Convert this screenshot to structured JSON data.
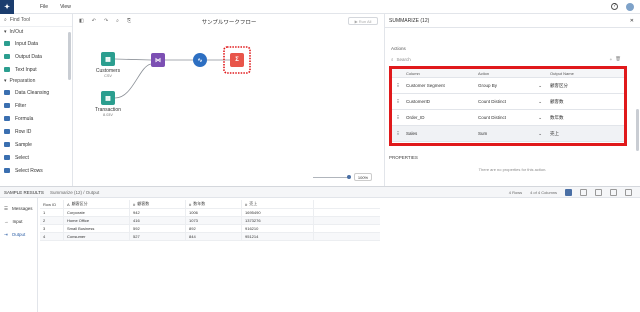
{
  "menu": {
    "file": "File",
    "view": "View"
  },
  "left_panel": {
    "find_tool": "Find Tool",
    "sections": [
      {
        "label": "In/Out",
        "items": [
          {
            "label": "Input Data",
            "color": "#2b9e8f"
          },
          {
            "label": "Output Data",
            "color": "#2b9e8f"
          },
          {
            "label": "Text Input",
            "color": "#2b9e8f"
          }
        ]
      },
      {
        "label": "Preparation",
        "items": [
          {
            "label": "Data Cleansing",
            "color": "#3a6fb0"
          },
          {
            "label": "Filter",
            "color": "#3a6fb0"
          },
          {
            "label": "Formula",
            "color": "#3a6fb0"
          },
          {
            "label": "Row ID",
            "color": "#3a6fb0"
          },
          {
            "label": "Sample",
            "color": "#3a6fb0"
          },
          {
            "label": "Select",
            "color": "#3a6fb0"
          },
          {
            "label": "Select Rows",
            "color": "#3a6fb0"
          }
        ]
      }
    ]
  },
  "canvas": {
    "title": "サンプルワークフロー",
    "run_all": "Run All",
    "zoom": "100%",
    "nodes": {
      "customers": {
        "label": "Customers",
        "sub": "CSV"
      },
      "transaction": {
        "label": "Transaction",
        "sub": "8.03V"
      }
    }
  },
  "summary": {
    "header": "SUMMARIZE (12)",
    "actions_label": "Actions",
    "search_placeholder": "Search",
    "columns": {
      "column": "Column",
      "action": "Action",
      "output": "Output Name"
    },
    "rows": [
      {
        "column": "Customer Segment",
        "action": "Group By",
        "output": "顧客区分"
      },
      {
        "column": "CustomerID",
        "action": "Count Distinct",
        "output": "顧客数"
      },
      {
        "column": "Order_ID",
        "action": "Count Distinct",
        "output": "数年数"
      },
      {
        "column": "Sales",
        "action": "Sum",
        "output": "売上"
      }
    ],
    "properties_label": "PROPERTIES",
    "no_props": "There are no properties for this action."
  },
  "results": {
    "title": "SAMPLE RESULTS",
    "crumb": "Summarize (12) / Output",
    "rows_label": "4 Rows",
    "cols_label": "4 of 4 Columns",
    "tabs": [
      {
        "label": "Messages"
      },
      {
        "label": "Input"
      },
      {
        "label": "Output"
      }
    ],
    "grid": {
      "headers": [
        "Row ID",
        "顧客区分",
        "顧客数",
        "数年数",
        "売上"
      ],
      "rows": [
        [
          "1",
          "Corporate",
          "942",
          "1006",
          "1695490"
        ],
        [
          "2",
          "Home Office",
          "416",
          "1073",
          "1373276"
        ],
        [
          "3",
          "Small Business",
          "592",
          "892",
          "916210"
        ],
        [
          "4",
          "Consumer",
          "527",
          "844",
          "951214"
        ]
      ]
    }
  }
}
